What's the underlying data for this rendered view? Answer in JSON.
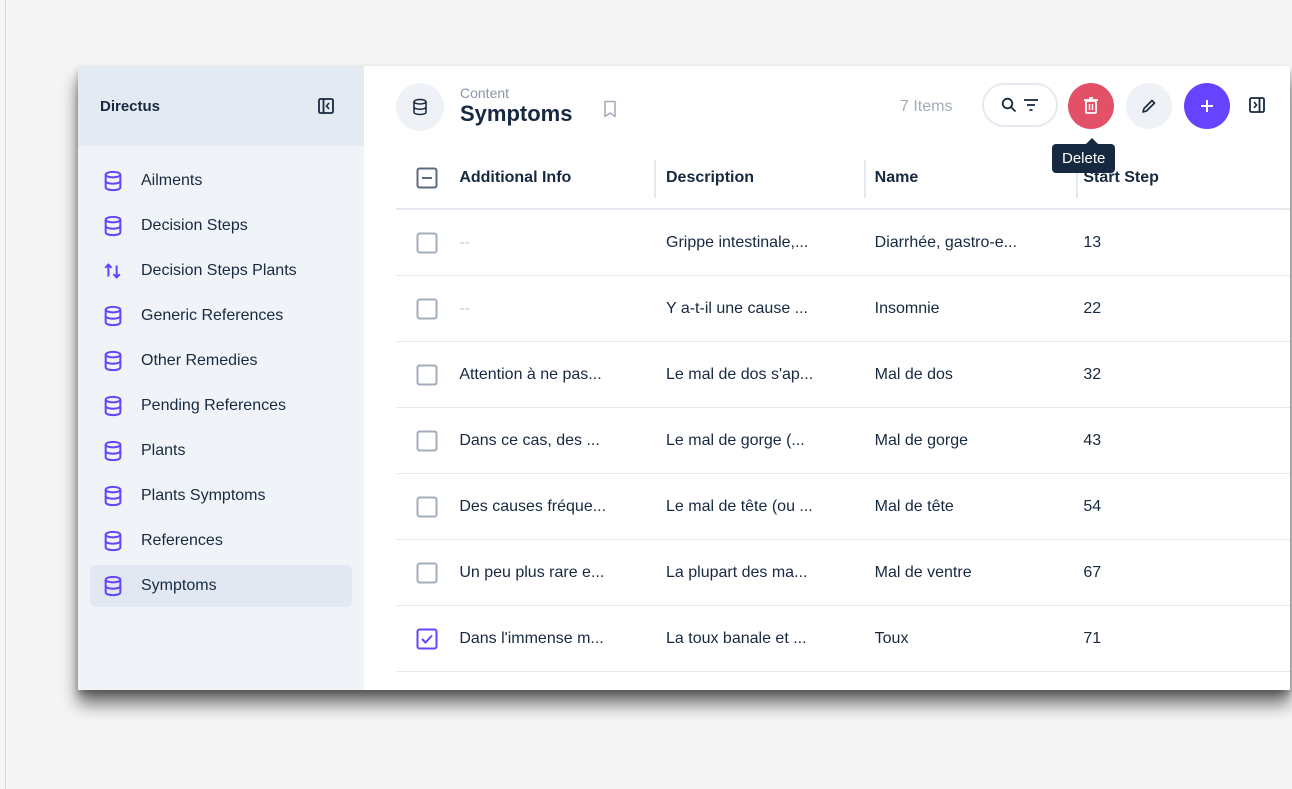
{
  "sidebar": {
    "title": "Directus",
    "items": [
      {
        "label": "Ailments",
        "icon": "database-icon"
      },
      {
        "label": "Decision Steps",
        "icon": "database-icon"
      },
      {
        "label": "Decision Steps Plants",
        "icon": "import-export-icon"
      },
      {
        "label": "Generic References",
        "icon": "database-icon"
      },
      {
        "label": "Other Remedies",
        "icon": "database-icon"
      },
      {
        "label": "Pending References",
        "icon": "database-icon"
      },
      {
        "label": "Plants",
        "icon": "database-icon"
      },
      {
        "label": "Plants Symptoms",
        "icon": "database-icon"
      },
      {
        "label": "References",
        "icon": "database-icon"
      },
      {
        "label": "Symptoms",
        "icon": "database-icon",
        "active": true
      }
    ]
  },
  "header": {
    "breadcrumb": "Content",
    "title": "Symptoms",
    "item_count": "7 Items",
    "tooltip": "Delete"
  },
  "table": {
    "columns": [
      "Additional Info",
      "Description",
      "Name",
      "Start Step"
    ],
    "rows": [
      {
        "additional_info": "--",
        "description": "Grippe intestinale,...",
        "name": "Diarrhée, gastro-e...",
        "start_step": "13",
        "checked": false
      },
      {
        "additional_info": "--",
        "description": "Y a-t-il une cause ...",
        "name": "Insomnie",
        "start_step": "22",
        "checked": false
      },
      {
        "additional_info": "Attention à ne pas...",
        "description": "Le mal de dos s'ap...",
        "name": "Mal de dos",
        "start_step": "32",
        "checked": false
      },
      {
        "additional_info": "Dans ce cas, des ...",
        "description": "Le mal de gorge (...",
        "name": "Mal de gorge",
        "start_step": "43",
        "checked": false
      },
      {
        "additional_info": "Des causes fréque...",
        "description": "Le mal de tête (ou ...",
        "name": "Mal de tête",
        "start_step": "54",
        "checked": false
      },
      {
        "additional_info": "Un peu plus rare e...",
        "description": "La plupart des ma...",
        "name": "Mal de ventre",
        "start_step": "67",
        "checked": false
      },
      {
        "additional_info": "Dans l'immense m...",
        "description": "La toux banale et ...",
        "name": "Toux",
        "start_step": "71",
        "checked": true
      }
    ]
  },
  "colors": {
    "accent": "#6644ff",
    "danger": "#e35169",
    "text": "#172940",
    "muted": "#a3adbb"
  }
}
